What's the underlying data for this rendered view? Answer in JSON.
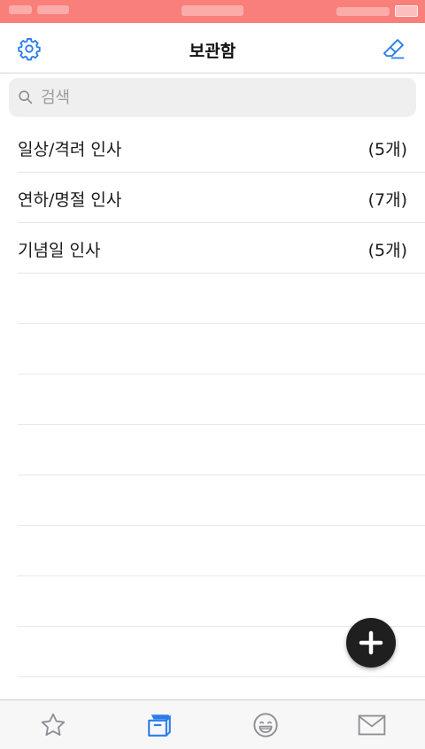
{
  "header": {
    "title": "보관함",
    "left_icon": "gear-icon",
    "right_icon": "eraser-icon"
  },
  "search": {
    "placeholder": "검색",
    "icon": "search-icon"
  },
  "list": {
    "items": [
      {
        "label": "일상/격려 인사",
        "count": "(5개)"
      },
      {
        "label": "연하/명절 인사",
        "count": "(7개)"
      },
      {
        "label": "기념일 인사",
        "count": "(5개)"
      }
    ]
  },
  "fab": {
    "icon": "plus-icon"
  },
  "tabbar": {
    "items": [
      {
        "icon": "star-icon",
        "active": false
      },
      {
        "icon": "archive-box-icon",
        "active": true
      },
      {
        "icon": "smiley-icon",
        "active": false
      },
      {
        "icon": "mail-icon",
        "active": false
      }
    ]
  },
  "colors": {
    "accent": "#2b7de9",
    "status_bar": "#f97f7a",
    "inactive_icon": "#8e8e93"
  }
}
